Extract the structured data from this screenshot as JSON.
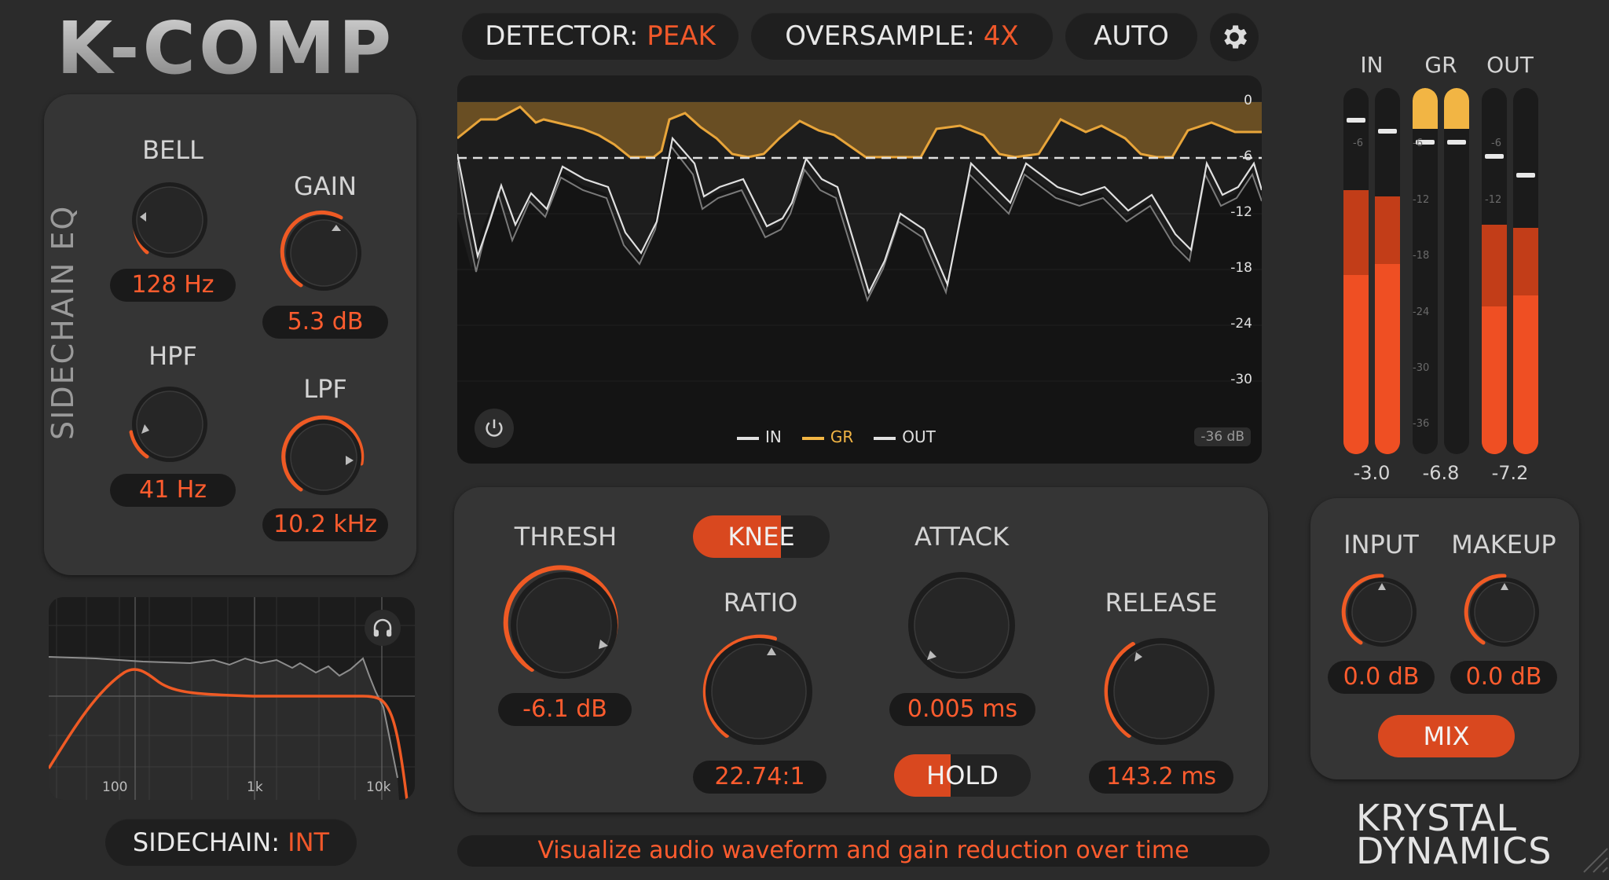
{
  "app": {
    "title": "K-COMP"
  },
  "toolbar": {
    "detector_label": "DETECTOR:",
    "detector_value": "PEAK",
    "oversample_label": "OVERSAMPLE:",
    "oversample_value": "4X",
    "auto_label": "AUTO"
  },
  "sidechain_eq": {
    "title": "SIDECHAIN EQ",
    "bell": {
      "label": "BELL",
      "value": "128 Hz"
    },
    "gain": {
      "label": "GAIN",
      "value": "5.3 dB"
    },
    "hpf": {
      "label": "HPF",
      "value": "41 Hz"
    },
    "lpf": {
      "label": "LPF",
      "value": "10.2 kHz"
    }
  },
  "eq_curve": {
    "ticks": [
      "100",
      "1k",
      "10k"
    ]
  },
  "sidechain": {
    "label": "SIDECHAIN:",
    "value": "INT"
  },
  "waveform": {
    "scale": [
      "0",
      "-6",
      "-12",
      "-18",
      "-24",
      "-30"
    ],
    "floor": "-36 dB",
    "legend": [
      {
        "name": "IN"
      },
      {
        "name": "GR"
      },
      {
        "name": "OUT"
      }
    ]
  },
  "controls": {
    "thresh": {
      "label": "THRESH",
      "value": "-6.1 dB"
    },
    "knee": {
      "label": "KNEE"
    },
    "ratio": {
      "label": "RATIO",
      "value": "22.74:1"
    },
    "attack": {
      "label": "ATTACK",
      "value": "0.005 ms"
    },
    "hold": {
      "label": "HOLD"
    },
    "release": {
      "label": "RELEASE",
      "value": "143.2 ms"
    }
  },
  "meters": {
    "in": {
      "label": "IN",
      "value": "-3.0"
    },
    "gr": {
      "label": "GR",
      "value": "-6.8"
    },
    "out": {
      "label": "OUT",
      "value": "-7.2"
    },
    "ticks": [
      "-6",
      "-12",
      "-18",
      "-24",
      "-30",
      "-36"
    ]
  },
  "output": {
    "input": {
      "label": "INPUT",
      "value": "0.0 dB"
    },
    "makeup": {
      "label": "MAKEUP",
      "value": "0.0 dB"
    },
    "mix": {
      "label": "MIX"
    }
  },
  "brand": {
    "line1": "KRYSTAL",
    "line2": "DYNAMICS"
  },
  "status": {
    "tooltip": "Visualize audio waveform and gain reduction over time"
  },
  "colors": {
    "accent": "#f0582a",
    "gr": "#f2b544"
  }
}
